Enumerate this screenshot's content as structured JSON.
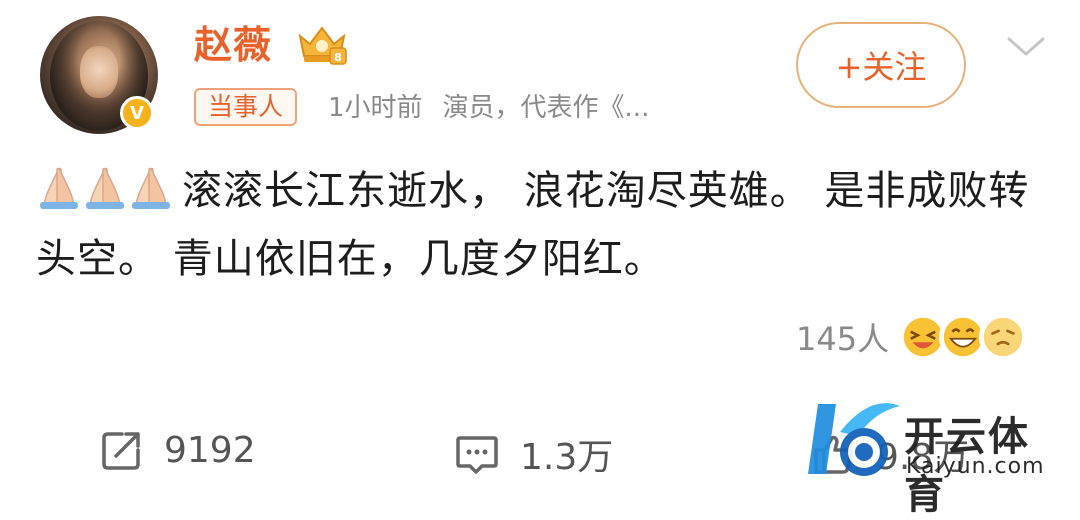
{
  "post": {
    "author_name": "赵薇",
    "tag": "当事人",
    "time": "1小时前",
    "bio": "演员，代表作《...",
    "follow_label": "+关注",
    "verified_badge": "V",
    "content": "滚滚长江东逝水， 浪花淘尽英雄。 是非成败转头空。 青山依旧在，几度夕阳红。"
  },
  "reactions": {
    "count": "145人",
    "emojis": [
      "laughing-face-icon",
      "grinning-face-icon",
      "squinting-face-icon"
    ]
  },
  "actions": {
    "repost_count": "9192",
    "comment_count": "1.3万",
    "like_count": "9.8万"
  },
  "watermark": {
    "cn": "开云体育",
    "en": "Kaiyun.com"
  },
  "colors": {
    "accent": "#e8622a",
    "muted": "#8a8a8a",
    "badge": "#f6b21b"
  }
}
